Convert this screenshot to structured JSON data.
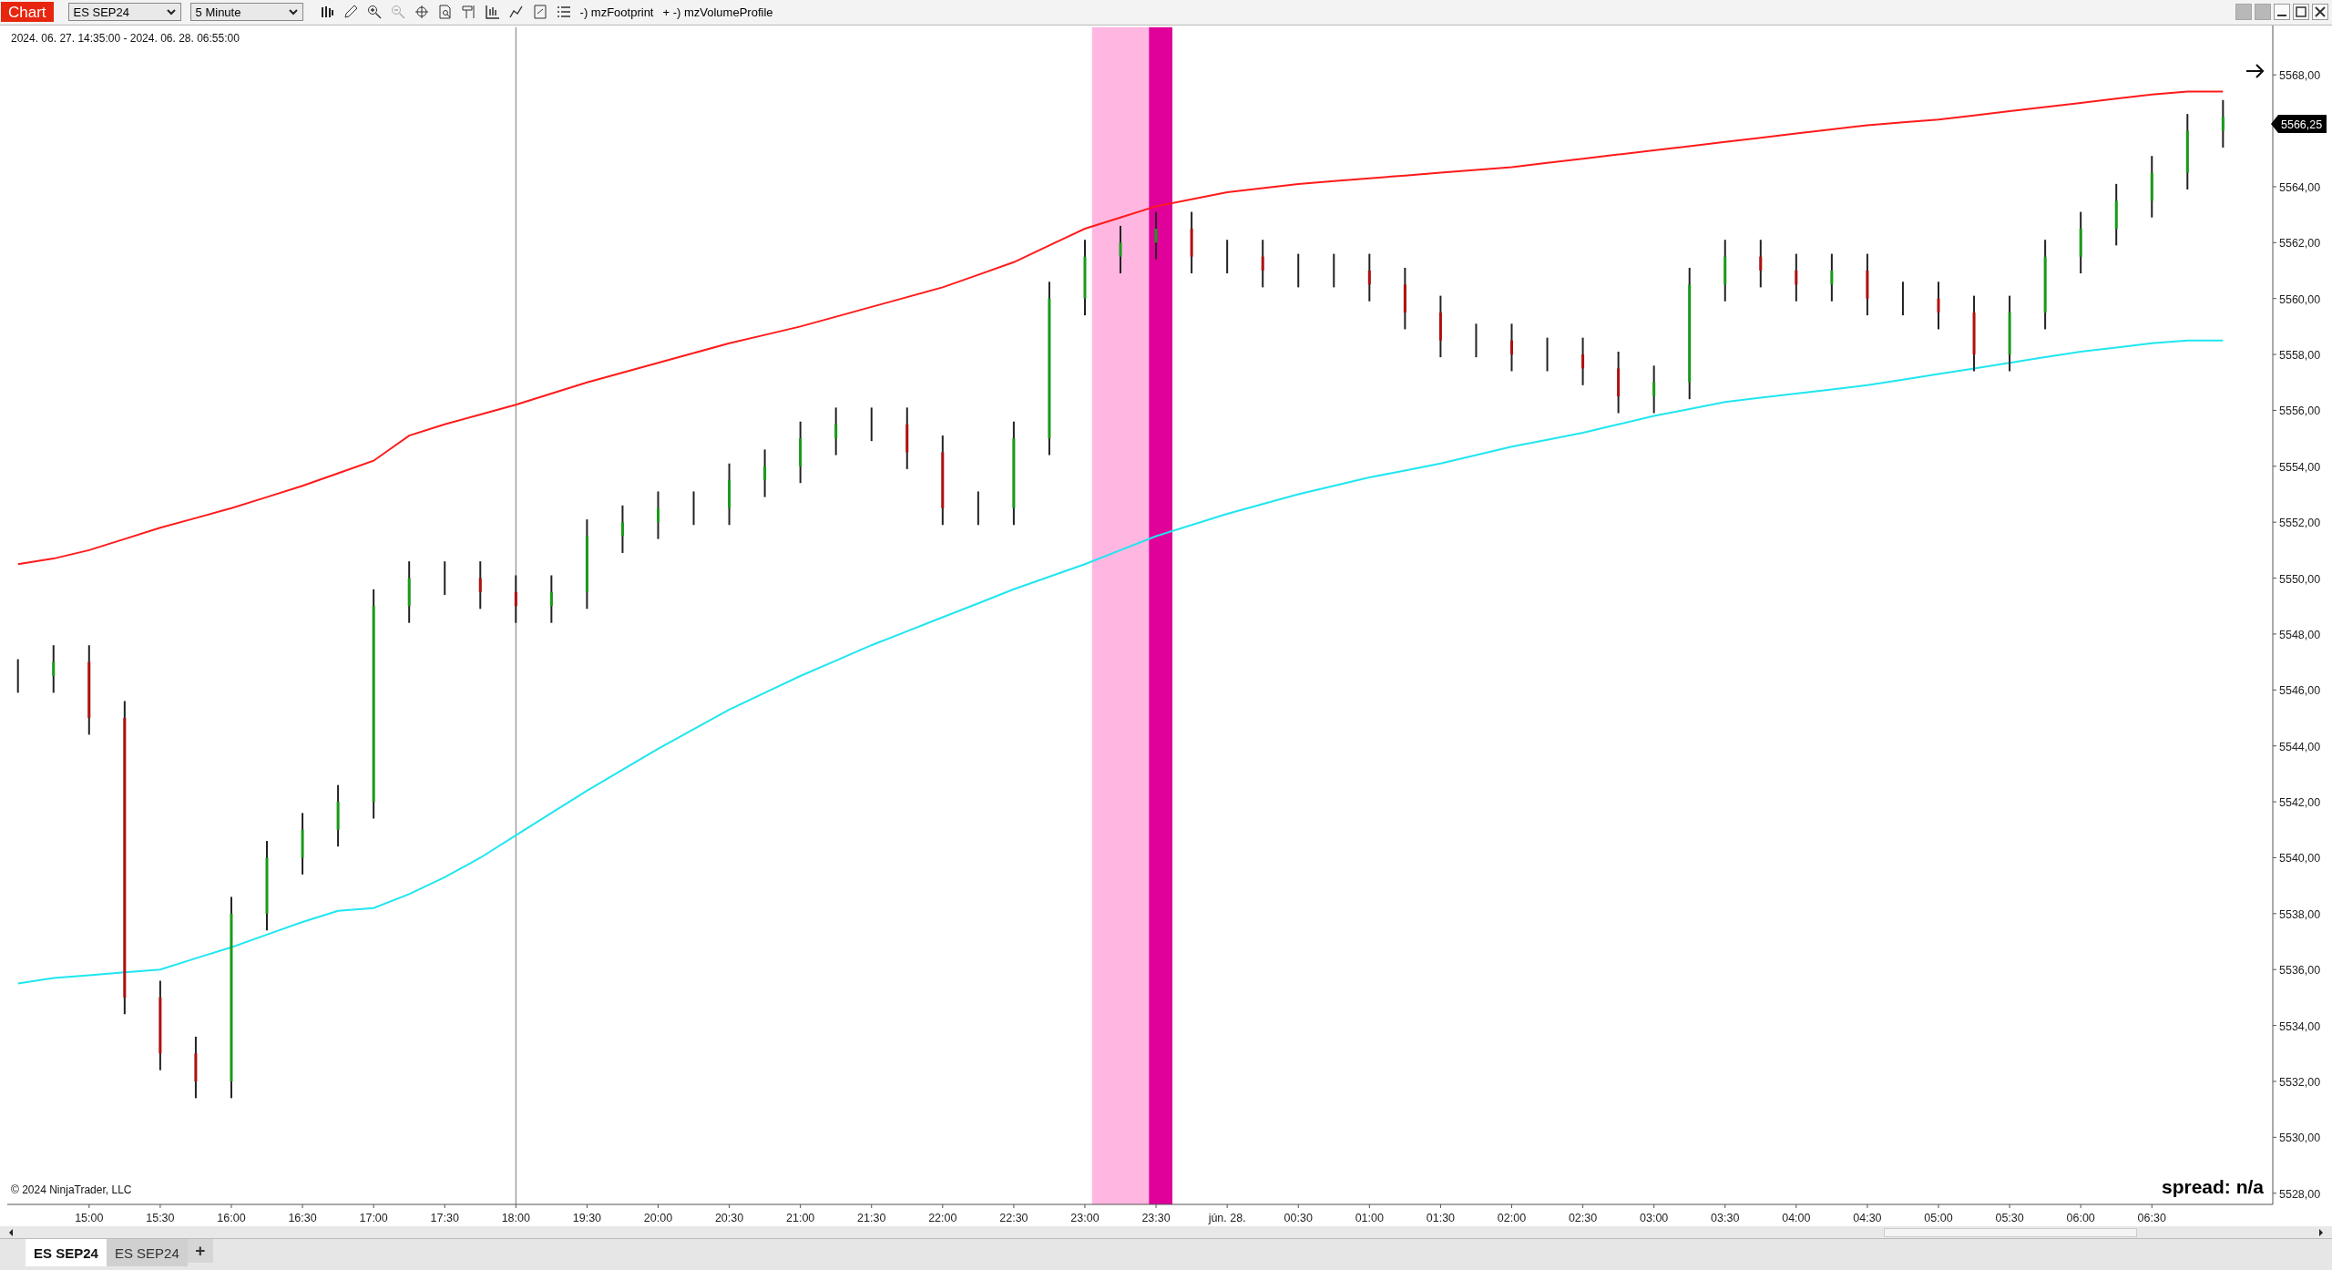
{
  "toolbar": {
    "app_label": "Chart",
    "instrument": "ES SEP24",
    "interval": "5 Minute",
    "indicators": [
      {
        "prefix": "-)",
        "name": "mzFootprint"
      },
      {
        "prefix": "+ -)",
        "name": "mzVolumeProfile"
      }
    ]
  },
  "chart": {
    "range": "2024. 06. 27. 14:35:00 - 2024. 06. 28. 06:55:00",
    "copyright": "© 2024 NinjaTrader, LLC",
    "spread": "spread: n/a",
    "chart_data": {
      "type": "line",
      "categories": [
        null,
        null,
        "15:00",
        null,
        "15:30",
        null,
        "16:00",
        null,
        "16:30",
        null,
        "17:00",
        null,
        "17:30",
        null,
        "18:00",
        null,
        "19:30",
        null,
        "20:00",
        null,
        "20:30",
        null,
        "21:00",
        null,
        "21:30",
        null,
        "22:00",
        null,
        "22:30",
        null,
        "23:00",
        null,
        "23:30",
        null,
        "jún. 28.",
        null,
        "00:30",
        null,
        "01:00",
        null,
        "01:30",
        null,
        "02:00",
        null,
        "02:30",
        null,
        "03:00",
        null,
        "03:30",
        null,
        "04:00",
        null,
        "04:30",
        null,
        "05:00",
        null,
        "05:30",
        null,
        "06:00",
        null,
        "06:30",
        null,
        null
      ],
      "series": [
        {
          "color": "#ff1a1a",
          "values": [
            5550.5,
            5550.7,
            5551,
            5551.4,
            5551.8,
            5552.15,
            5552.5,
            5552.9,
            5553.3,
            5553.75,
            5554.2,
            5555.1,
            5555.5,
            5555.85,
            5556.2,
            5556.6,
            5557,
            5557.35,
            5557.7,
            5558.05,
            5558.4,
            5558.7,
            5559,
            5559.35,
            5559.7,
            5560.05,
            5560.4,
            5560.85,
            5561.3,
            5561.9,
            5562.5,
            5562.9,
            5563.3,
            5563.55,
            5563.8,
            5563.95,
            5564.1,
            5564.2,
            5564.3,
            5564.4,
            5564.5,
            5564.6,
            5564.7,
            5564.85,
            5565,
            5565.15,
            5565.3,
            5565.45,
            5565.6,
            5565.75,
            5565.9,
            5566.05,
            5566.2,
            5566.3,
            5566.4,
            5566.55,
            5566.7,
            5566.85,
            5567,
            5567.15,
            5567.3,
            5567.4,
            5567.4
          ]
        },
        {
          "color": "#1fe6f0",
          "values": [
            5535.5,
            5535.7,
            5535.8,
            5535.9,
            5536,
            5536.4,
            5536.8,
            5537.25,
            5537.7,
            5538.1,
            5538.2,
            5538.7,
            5539.3,
            5540,
            5540.8,
            5541.6,
            5542.4,
            5543.15,
            5543.9,
            5544.6,
            5545.3,
            5545.9,
            5546.5,
            5547.05,
            5547.6,
            5548.1,
            5548.6,
            5549.1,
            5549.6,
            5550.05,
            5550.5,
            5551,
            5551.5,
            5551.9,
            5552.3,
            5552.65,
            5553,
            5553.3,
            5553.6,
            5553.85,
            5554.1,
            5554.4,
            5554.7,
            5554.95,
            5555.2,
            5555.5,
            5555.8,
            5556.05,
            5556.3,
            5556.45,
            5556.6,
            5556.75,
            5556.9,
            5557.1,
            5557.3,
            5557.5,
            5557.7,
            5557.9,
            5558.1,
            5558.25,
            5558.4,
            5558.5,
            5558.5
          ]
        }
      ],
      "ylim": [
        5527.6,
        5569.7
      ],
      "yticks": [
        {
          "value": 5568,
          "label": "5568,00"
        },
        {
          "value": 5564,
          "label": "5564,00"
        },
        {
          "value": 5562,
          "label": "5562,00"
        },
        {
          "value": 5560,
          "label": "5560,00"
        },
        {
          "value": 5558,
          "label": "5558,00"
        },
        {
          "value": 5556,
          "label": "5556,00"
        },
        {
          "value": 5554,
          "label": "5554,00"
        },
        {
          "value": 5552,
          "label": "5552,00"
        },
        {
          "value": 5550,
          "label": "5550,00"
        },
        {
          "value": 5548,
          "label": "5548,00"
        },
        {
          "value": 5546,
          "label": "5546,00"
        },
        {
          "value": 5544,
          "label": "5544,00"
        },
        {
          "value": 5542,
          "label": "5542,00"
        },
        {
          "value": 5540,
          "label": "5540,00"
        },
        {
          "value": 5538,
          "label": "5538,00"
        },
        {
          "value": 5536,
          "label": "5536,00"
        },
        {
          "value": 5534,
          "label": "5534,00"
        },
        {
          "value": 5532,
          "label": "5532,00"
        },
        {
          "value": 5530,
          "label": "5530,00"
        },
        {
          "value": 5528,
          "label": "5528,00"
        }
      ],
      "annotations": [
        "5566,25"
      ]
    }
  },
  "tabs": [
    {
      "label": "ES SEP24",
      "selected": true
    },
    {
      "label": "ES SEP24",
      "selected": false
    }
  ],
  "add_tab": "+"
}
